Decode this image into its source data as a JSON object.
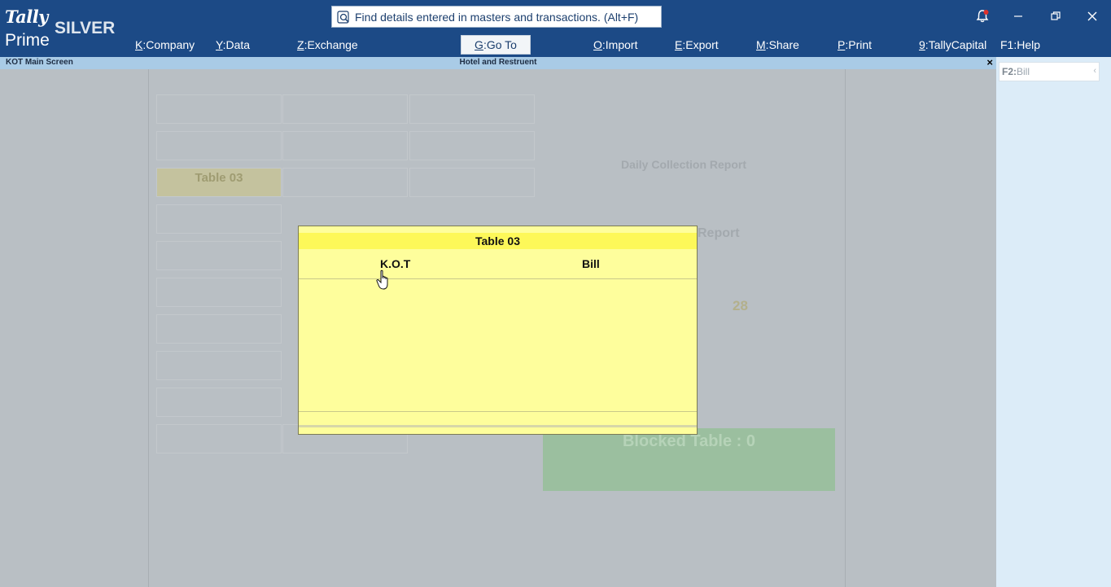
{
  "logo": {
    "line1": "Tally",
    "line2": "Prime",
    "edition": "SILVER"
  },
  "search": {
    "placeholder": "Find details entered in masters and transactions. (Alt+F)"
  },
  "menu": [
    {
      "key": "K",
      "label": "Company"
    },
    {
      "key": "Y",
      "label": "Data"
    },
    {
      "key": "Z",
      "label": "Exchange"
    },
    {
      "key": "G",
      "label": "Go To"
    },
    {
      "key": "O",
      "label": "Import"
    },
    {
      "key": "E",
      "label": "Export"
    },
    {
      "key": "M",
      "label": "Share"
    },
    {
      "key": "P",
      "label": "Print"
    },
    {
      "key": "9",
      "label": "TallyCapital"
    },
    {
      "key": "F1",
      "label": "Help"
    }
  ],
  "subbar": {
    "screen": "KOT Main Screen",
    "company": "Hotel and Restruent",
    "close": "×"
  },
  "background": {
    "table_label": "Table 03",
    "daily_report": "Daily Collection Report",
    "report_fragment": "Report",
    "count_fragment": "28",
    "green_box": "Blocked Table : 0"
  },
  "right_panel": {
    "f2_key": "F2:",
    "f2_label": "Bill"
  },
  "popup": {
    "title": "Table 03",
    "kot": "K.O.T",
    "bill": "Bill"
  },
  "colors": {
    "topbar": "#1c4a86",
    "popup": "#fefe9c",
    "popup_title": "#fdf859",
    "subbar": "#a9cbe6"
  }
}
